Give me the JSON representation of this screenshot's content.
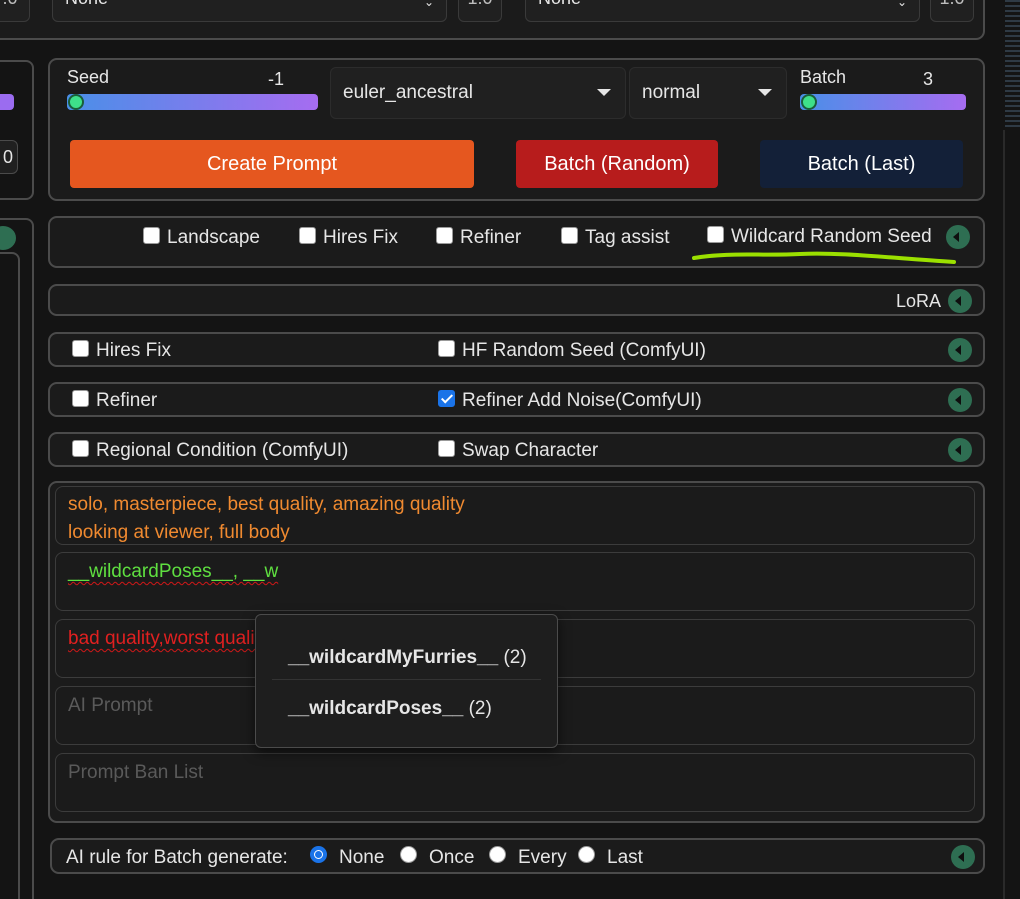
{
  "top": {
    "select1_value": "None",
    "num1_value": "1.0",
    "select2_value": "None",
    "num2_value": "1.0",
    "left_partial_value": ".0"
  },
  "left": {
    "partial_number": "0"
  },
  "controls": {
    "seed_label": "Seed",
    "seed_value": "-1",
    "sampler_value": "euler_ancestral",
    "scheduler_value": "normal",
    "batch_label": "Batch",
    "batch_value": "3"
  },
  "buttons": {
    "create_prompt": "Create Prompt",
    "batch_random": "Batch (Random)",
    "batch_last": "Batch (Last)"
  },
  "options_row": {
    "landscape": "Landscape",
    "hires_fix": "Hires Fix",
    "refiner": "Refiner",
    "tag_assist": "Tag assist",
    "wildcard_random_seed": "Wildcard Random Seed"
  },
  "lora": {
    "label": "LoRA"
  },
  "hires_row": {
    "hires_fix": "Hires Fix",
    "hf_random_seed": "HF Random Seed (ComfyUI)"
  },
  "refiner_row": {
    "refiner": "Refiner",
    "refiner_add_noise": "Refiner Add Noise(ComfyUI)"
  },
  "regional_row": {
    "regional_condition": "Regional Condition (ComfyUI)",
    "swap_character": "Swap Character"
  },
  "prompts": {
    "positive_line1": "solo, masterpiece, best quality, amazing quality",
    "positive_line2": "looking at viewer, full body",
    "wildcard_text": "__wildcardPoses__, __w",
    "negative_text": "bad quality,worst quality,worst detail,sketch,3d",
    "ai_prompt_placeholder": "AI Prompt",
    "ban_list_placeholder": "Prompt Ban List"
  },
  "autocomplete": {
    "items": [
      {
        "name": "__wildcardMyFurries__",
        "count": "(2)"
      },
      {
        "name": "__wildcardPoses__",
        "count": "(2)"
      }
    ]
  },
  "ai_rule": {
    "label": "AI rule for Batch generate:",
    "options": [
      "None",
      "Once",
      "Every",
      "Last"
    ],
    "selected": "None"
  },
  "colors": {
    "accent_orange": "#e5571f",
    "batch_random_red": "#b71c1c",
    "batch_last_navy": "#132038",
    "positive_text": "#f08a30",
    "wildcard_text": "#5fe040",
    "negative_text": "#e02020",
    "annotation_green": "#9be000"
  }
}
